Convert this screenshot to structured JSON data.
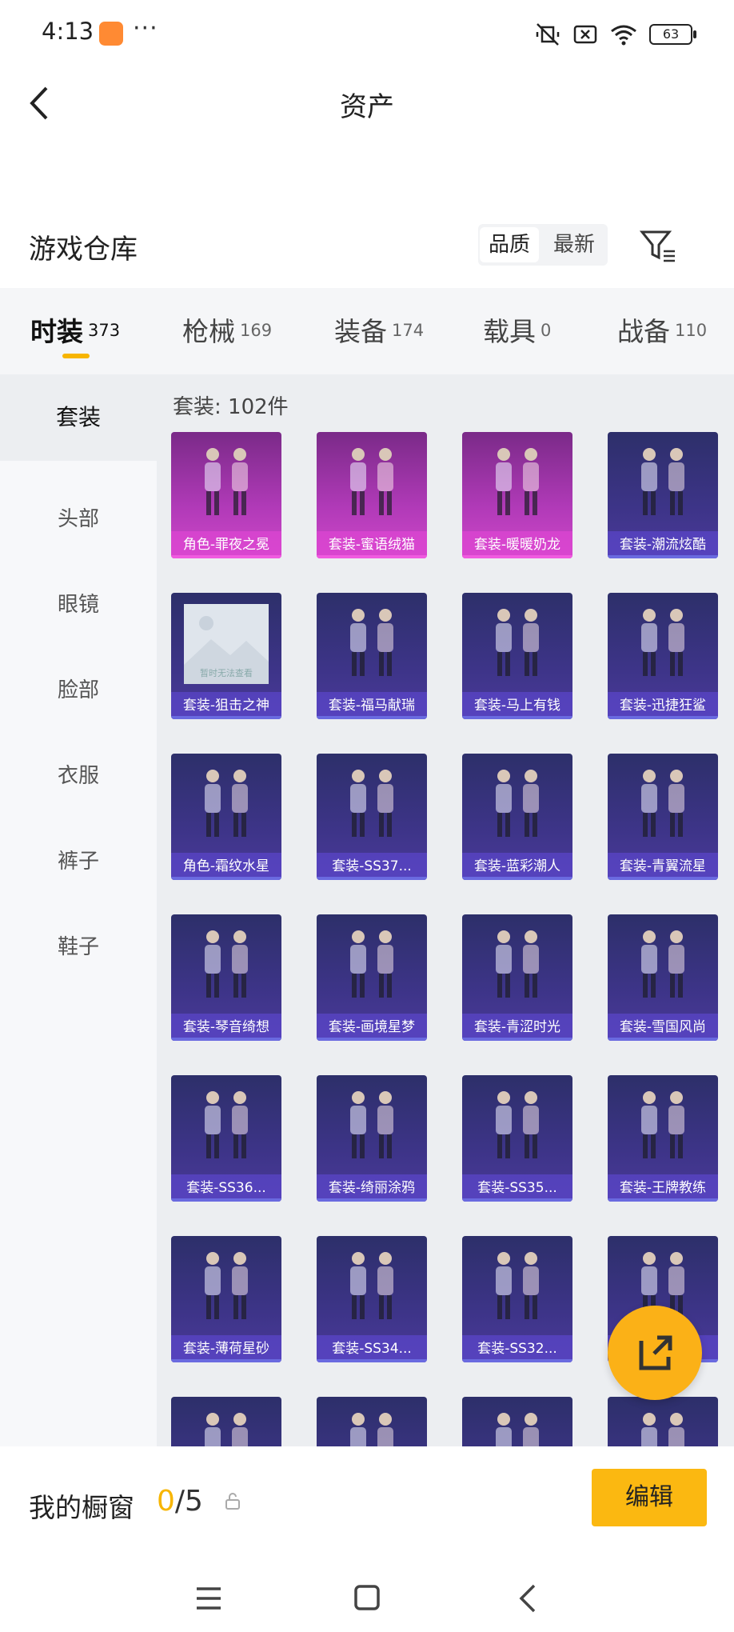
{
  "status_bar": {
    "time": "4:13",
    "dots": "···",
    "battery": "63"
  },
  "header": {
    "title": "资产"
  },
  "warehouse": {
    "label": "游戏仓库",
    "sort_quality": "品质",
    "sort_newest": "最新"
  },
  "tabs": [
    {
      "label": "时装",
      "count": "373"
    },
    {
      "label": "枪械",
      "count": "169"
    },
    {
      "label": "装备",
      "count": "174"
    },
    {
      "label": "载具",
      "count": "0"
    },
    {
      "label": "战备",
      "count": "110"
    }
  ],
  "sidebar": {
    "items": [
      {
        "label": "套装"
      },
      {
        "label": "头部"
      },
      {
        "label": "眼镜"
      },
      {
        "label": "脸部"
      },
      {
        "label": "衣服"
      },
      {
        "label": "裤子"
      },
      {
        "label": "鞋子"
      }
    ]
  },
  "content": {
    "count_label": "套装: 102件",
    "no_image_text": "暂时无法查看",
    "items": [
      {
        "name": "角色-罪夜之冕",
        "rarity": "pink"
      },
      {
        "name": "套装-蜜语绒猫",
        "rarity": "pink"
      },
      {
        "name": "套装-暖暖奶龙",
        "rarity": "pink"
      },
      {
        "name": "套装-潮流炫酷",
        "rarity": "blue"
      },
      {
        "name": "套装-狙击之神",
        "rarity": "blue",
        "no_image": true
      },
      {
        "name": "套装-福马献瑞",
        "rarity": "blue"
      },
      {
        "name": "套装-马上有钱",
        "rarity": "blue"
      },
      {
        "name": "套装-迅捷狂鲨",
        "rarity": "blue"
      },
      {
        "name": "角色-霜纹水星",
        "rarity": "blue"
      },
      {
        "name": "套装-SS37...",
        "rarity": "blue"
      },
      {
        "name": "套装-蓝彩潮人",
        "rarity": "blue"
      },
      {
        "name": "套装-青翼流星",
        "rarity": "blue"
      },
      {
        "name": "套装-琴音绮想",
        "rarity": "blue"
      },
      {
        "name": "套装-画境星梦",
        "rarity": "blue"
      },
      {
        "name": "套装-青涩时光",
        "rarity": "blue"
      },
      {
        "name": "套装-雪国风尚",
        "rarity": "blue"
      },
      {
        "name": "套装-SS36...",
        "rarity": "blue"
      },
      {
        "name": "套装-绮丽涂鸦",
        "rarity": "blue"
      },
      {
        "name": "套装-SS35...",
        "rarity": "blue"
      },
      {
        "name": "套装-王牌教练",
        "rarity": "blue"
      },
      {
        "name": "套装-薄荷星砂",
        "rarity": "blue"
      },
      {
        "name": "套装-SS34...",
        "rarity": "blue"
      },
      {
        "name": "套装-SS32...",
        "rarity": "blue"
      },
      {
        "name": "戏",
        "rarity": "blue"
      },
      {
        "name": "",
        "rarity": "blue"
      },
      {
        "name": "",
        "rarity": "blue"
      },
      {
        "name": "",
        "rarity": "blue"
      },
      {
        "name": "",
        "rarity": "blue"
      }
    ]
  },
  "showcase": {
    "label": "我的橱窗",
    "current": "0",
    "total": "/5",
    "edit_label": "编辑"
  },
  "colors": {
    "accent": "#f7b500",
    "card_blue": "#3d3488",
    "card_pink": "#b13ab8"
  },
  "icons": [
    "back-arrow-icon",
    "filter-icon",
    "share-icon",
    "lock-icon",
    "menu-nav-icon",
    "home-nav-icon",
    "back-nav-icon"
  ]
}
